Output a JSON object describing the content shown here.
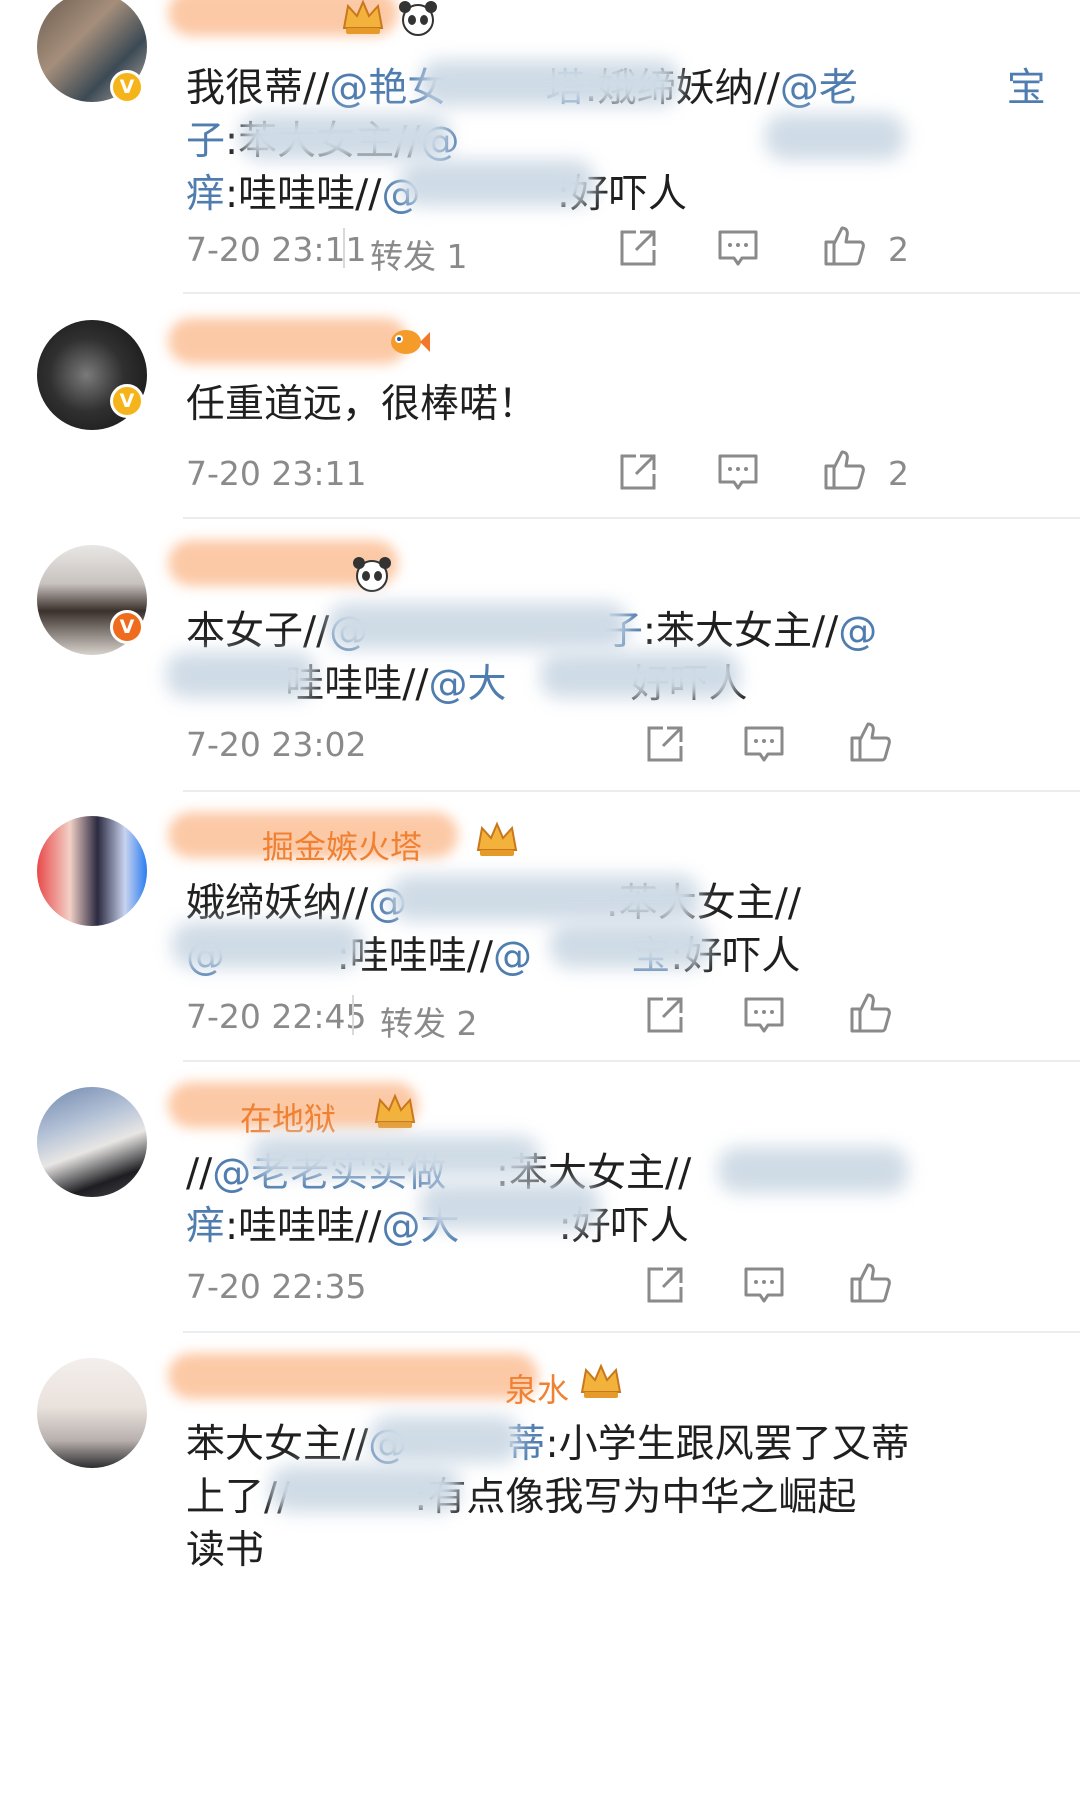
{
  "comments": [
    {
      "content": [
        {
          "t": "我很蒂//"
        },
        {
          "t": "@艳女",
          "m": true
        },
        {
          "t": "        "
        },
        {
          "t": "塔",
          "m": true
        },
        {
          "t": ":娥缔妖纳//"
        },
        {
          "t": "@老",
          "m": true
        },
        {
          "t": "            "
        },
        {
          "t": "宝子",
          "m": true
        },
        {
          "t": ":苯大女主//"
        },
        {
          "t": "@",
          "m": true
        },
        {
          "t": "\n"
        },
        {
          "t": "痒",
          "m": true
        },
        {
          "t": ":哇哇哇//"
        },
        {
          "t": "@",
          "m": true
        },
        {
          "t": "           "
        },
        {
          "t": ":好吓人"
        }
      ],
      "time": "7-20 23:11",
      "forward": "转发 1",
      "likes": "2"
    },
    {
      "content": [
        {
          "t": "任重道远，很棒喏！"
        }
      ],
      "time": "7-20 23:11",
      "forward": "",
      "likes": "2"
    },
    {
      "content": [
        {
          "t": "本女子//"
        },
        {
          "t": "@",
          "m": true
        },
        {
          "t": "                   "
        },
        {
          "t": "子",
          "m": true
        },
        {
          "t": ":苯大女主//"
        },
        {
          "t": "@",
          "m": true
        },
        {
          "t": "\n"
        },
        {
          "t": "        "
        },
        {
          "t": "哇哇哇//"
        },
        {
          "t": "@大",
          "m": true
        },
        {
          "t": "          "
        },
        {
          "t": "好吓人"
        }
      ],
      "time": "7-20 23:02",
      "forward": "",
      "likes": ""
    },
    {
      "name": "掘金嫉火塔",
      "content": [
        {
          "t": "娥缔妖纳//"
        },
        {
          "t": "@",
          "m": true
        },
        {
          "t": "                "
        },
        {
          "t": ":苯大女主//"
        },
        {
          "t": "\n"
        },
        {
          "t": "@",
          "m": true
        },
        {
          "t": "         "
        },
        {
          "t": ":哇哇哇//"
        },
        {
          "t": "@",
          "m": true
        },
        {
          "t": "        "
        },
        {
          "t": "宝",
          "m": true
        },
        {
          "t": ":好吓人"
        }
      ],
      "time": "7-20 22:45",
      "forward": "转发 2",
      "likes": ""
    },
    {
      "name": "在地狱",
      "content": [
        {
          "t": "//"
        },
        {
          "t": "@老老实实做",
          "m": true
        },
        {
          "t": "    "
        },
        {
          "t": ":苯大女主//"
        },
        {
          "t": "\n"
        },
        {
          "t": "痒",
          "m": true
        },
        {
          "t": ":哇哇哇//"
        },
        {
          "t": "@大",
          "m": true
        },
        {
          "t": "        "
        },
        {
          "t": ":好吓人"
        }
      ],
      "time": "7-20 22:35",
      "forward": "",
      "likes": ""
    },
    {
      "name": "泉水",
      "content": [
        {
          "t": "苯大女主//"
        },
        {
          "t": "@",
          "m": true
        },
        {
          "t": "        "
        },
        {
          "t": "蒂",
          "m": true
        },
        {
          "t": ":小学生跟风罢了又蒂"
        },
        {
          "t": "\n"
        },
        {
          "t": "上了//"
        },
        {
          "t": "          "
        },
        {
          "t": ":有点像我写为中华之崛起"
        },
        {
          "t": "\n"
        },
        {
          "t": "读书"
        }
      ],
      "time": "",
      "forward": "",
      "likes": ""
    }
  ],
  "icons": {
    "repost": "repost-icon",
    "comment": "comment-icon",
    "like": "like-icon",
    "verified": "verified-badge-icon",
    "crown": "crown-badge-icon",
    "panda": "panda-icon",
    "goldfish": "goldfish-icon"
  },
  "colors": {
    "mention": "#507daf",
    "meta": "#8a8a8a",
    "name": "#f08133",
    "verified_gold": "#f5b51a",
    "verified_orange": "#ef6b1e"
  }
}
